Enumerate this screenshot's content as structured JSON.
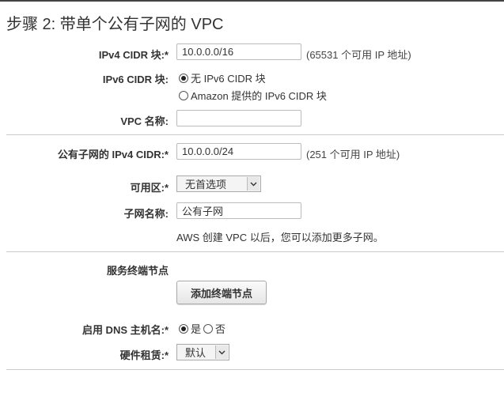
{
  "step_title": "步骤 2: 带单个公有子网的 VPC",
  "ipv4": {
    "label": "IPv4 CIDR 块:*",
    "value": "10.0.0.0/16",
    "hint": "(65531 个可用 IP 地址)"
  },
  "ipv6": {
    "label": "IPv6 CIDR 块:",
    "options": [
      "无 IPv6 CIDR 块",
      "Amazon 提供的 IPv6 CIDR 块"
    ],
    "selected": "无 IPv6 CIDR 块"
  },
  "vpc_name": {
    "label": "VPC 名称:",
    "value": ""
  },
  "public_subnet_ipv4": {
    "label": "公有子网的 IPv4 CIDR:*",
    "value": "10.0.0.0/24",
    "hint": "(251 个可用 IP 地址)"
  },
  "availability_zone": {
    "label": "可用区:*",
    "value": "无首选项"
  },
  "subnet_name": {
    "label": "子网名称:",
    "value": "公有子网",
    "note": "AWS 创建 VPC 以后，您可以添加更多子网。"
  },
  "service_endpoints": {
    "label": "服务终端节点",
    "button": "添加终端节点"
  },
  "dns_hostnames": {
    "label": "启用 DNS 主机名:*",
    "options": [
      "是",
      "否"
    ],
    "selected": "是"
  },
  "hardware_tenancy": {
    "label": "硬件租赁:*",
    "value": "默认"
  }
}
